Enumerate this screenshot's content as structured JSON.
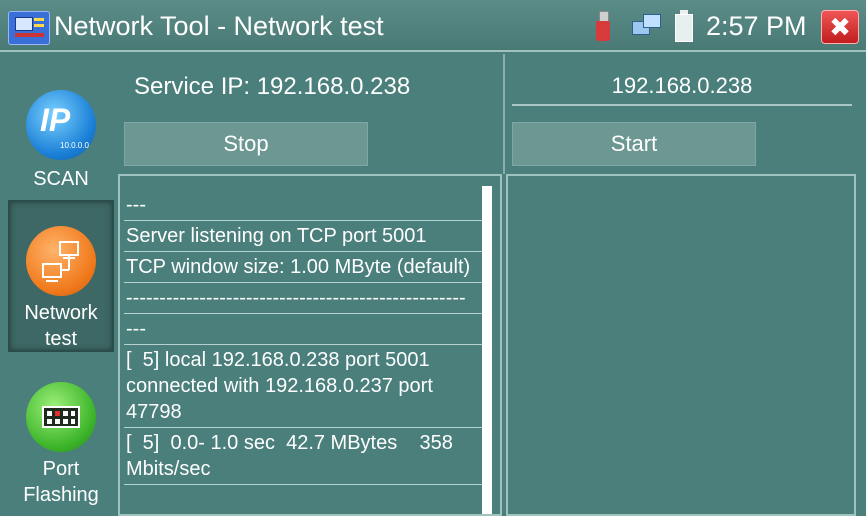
{
  "window": {
    "title": "Network Tool - Network test",
    "clock": "2:57 PM",
    "close_symbol": "✖"
  },
  "sidebar": {
    "items": [
      {
        "label": "SCAN",
        "icon": "ip-scan-icon",
        "icon_text": "IP",
        "icon_subtext": "10.0.0.0",
        "active": false
      },
      {
        "label": "Network test",
        "icon": "network-icon",
        "active": true
      },
      {
        "label": "Port Flashing",
        "icon": "port-icon",
        "active": false
      }
    ]
  },
  "server": {
    "service_ip_text": "Service IP: 192.168.0.238",
    "stop_label": "Stop"
  },
  "client": {
    "ip_value": "192.168.0.238",
    "start_label": "Start"
  },
  "output": {
    "lines": [
      "---",
      "Server listening on TCP port 5001",
      "TCP window size: 1.00 MByte (default)",
      "---------------------------------------------------",
      "---",
      "[  5] local 192.168.0.238 port 5001 connected with 192.168.0.237 port 47798",
      "[  5]  0.0- 1.0 sec  42.7 MBytes    358 Mbits/sec"
    ]
  },
  "colors": {
    "background": "#4a7f7b",
    "button": "#6c9793",
    "close": "#d63a3a"
  }
}
